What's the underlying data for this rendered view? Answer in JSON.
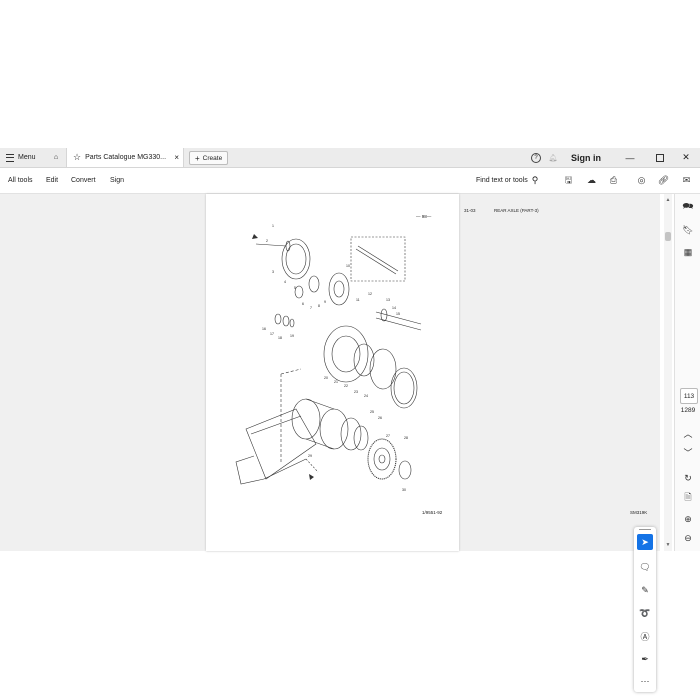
{
  "titlebar": {
    "menu_label": "Menu",
    "tab_title": "Parts Catalogue MG330...",
    "tab_close": "×",
    "create_label": "Create",
    "sign_in": "Sign in"
  },
  "toolbar": {
    "all_tools": "All tools",
    "edit": "Edit",
    "convert": "Convert",
    "sign": "Sign",
    "find_label": "Find text or tools"
  },
  "document": {
    "figure_number": "31-03",
    "figure_title": "REAR AXLE (PART-3)",
    "page_mark": "— 98—",
    "footer_code": "1/9551-92",
    "footer_ref": "SM319K",
    "callouts": [
      "1",
      "2",
      "3",
      "4",
      "5",
      "6",
      "7",
      "8",
      "9",
      "10",
      "11",
      "12",
      "13",
      "14",
      "15",
      "16",
      "17",
      "18",
      "19",
      "20",
      "21",
      "22",
      "23",
      "24",
      "25",
      "26",
      "27",
      "28",
      "29",
      "30"
    ]
  },
  "navigation": {
    "current_page": "113",
    "total_pages": "1289"
  },
  "colors": {
    "accent": "#1473e6",
    "tab_bar": "#ececec",
    "viewer_background": "#f0f0f0"
  },
  "icons": {
    "home": "home-icon",
    "star": "star-icon",
    "help": "help-icon",
    "bell": "bell-icon",
    "search": "search-icon",
    "select": "cursor-icon"
  }
}
